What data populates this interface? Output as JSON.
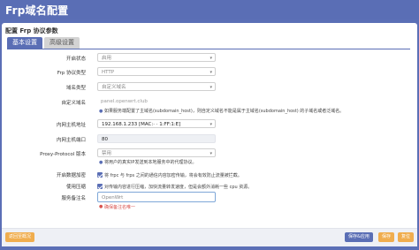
{
  "page": {
    "title": "Frp域名配置"
  },
  "panel": {
    "header": "配置 Frp 协议参数",
    "tabs": [
      {
        "label": "基本设置"
      },
      {
        "label": "高级设置"
      }
    ]
  },
  "form": {
    "enabled": {
      "label": "开启状态",
      "value": "启用"
    },
    "protocol": {
      "label": "Frp 协议类型",
      "value": "HTTP"
    },
    "domain_type": {
      "label": "域名类型",
      "value": "自定义域名"
    },
    "custom_domain": {
      "label": "自定义域名",
      "placeholder": "panel.openwrt.club",
      "help": "如果服务端配置了主域名(subdomain_host)，则自定义域名不能是属于主域名(subdomain_host) 的子域名或者泛域名。"
    },
    "local_host": {
      "label": "内网主机地址",
      "value": "192.168.1.233 [MAC:·   ·   1:FF:1:E]"
    },
    "local_port": {
      "label": "内网主机端口",
      "value": "80"
    },
    "proxy_protocol": {
      "label": "Proxy-Protocol 版本",
      "value": "禁用",
      "help": "将用户的真实IP发送到本地服务中的代理协议。"
    },
    "encryption": {
      "label": "开启数据加密",
      "help": "将 frpc 与 frps 之间的通信内容加密传输，将会有效防止流量被拦截。"
    },
    "compression": {
      "label": "使用压缩",
      "help": "对传输内容进行压缩，加快流量转发速度，但是会额外消耗一些 cpu 资源。"
    },
    "remark": {
      "label": "服务备注名",
      "placeholder": "OpenWrt",
      "error": "确保备注名唯一"
    }
  },
  "footer": {
    "reset_label": "返回至概况",
    "save_apply_label": "保存&应用",
    "save_label": "保存",
    "reset_btn_label": "复位"
  }
}
